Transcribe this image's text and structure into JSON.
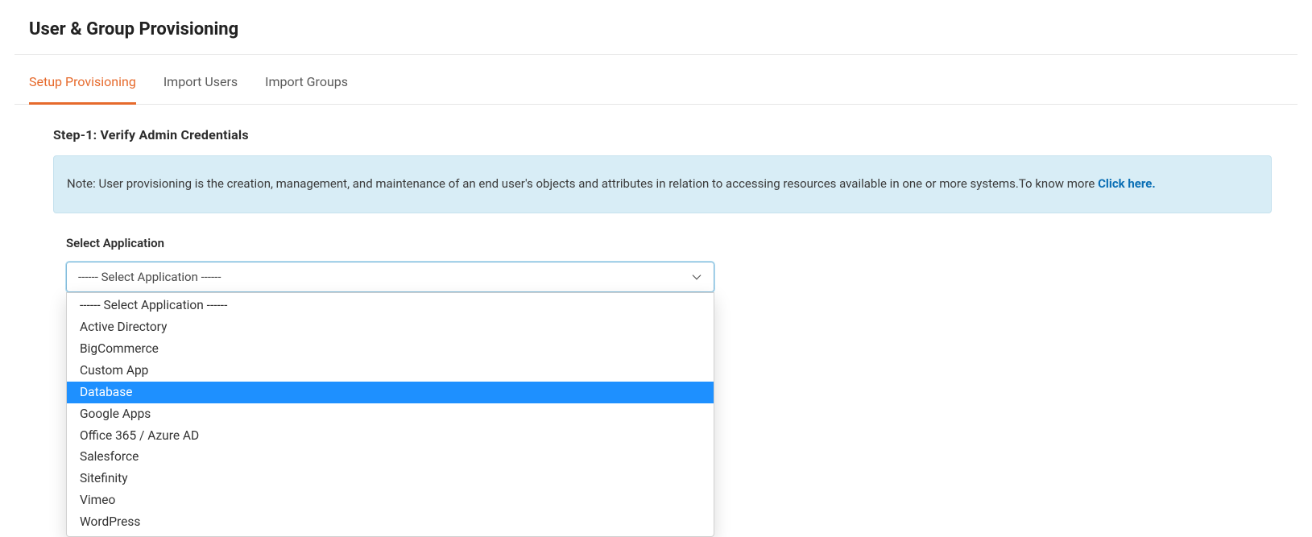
{
  "header": {
    "title": "User & Group Provisioning"
  },
  "tabs": {
    "items": [
      {
        "label": "Setup Provisioning",
        "active": true
      },
      {
        "label": "Import Users",
        "active": false
      },
      {
        "label": "Import Groups",
        "active": false
      }
    ]
  },
  "step": {
    "title": "Step-1: Verify Admin Credentials"
  },
  "note": {
    "prefix": "Note: User provisioning is the creation, management, and maintenance of an end user's objects and attributes in relation to accessing resources available in one or more systems.To know more ",
    "link": "Click here."
  },
  "field": {
    "label": "Select Application",
    "selected": "------ Select Application ------",
    "options": [
      {
        "label": "------ Select Application ------",
        "highlight": false
      },
      {
        "label": "Active Directory",
        "highlight": false
      },
      {
        "label": "BigCommerce",
        "highlight": false
      },
      {
        "label": "Custom App",
        "highlight": false
      },
      {
        "label": "Database",
        "highlight": true
      },
      {
        "label": "Google Apps",
        "highlight": false
      },
      {
        "label": "Office 365 / Azure AD",
        "highlight": false
      },
      {
        "label": "Salesforce",
        "highlight": false
      },
      {
        "label": "Sitefinity",
        "highlight": false
      },
      {
        "label": "Vimeo",
        "highlight": false
      },
      {
        "label": "WordPress",
        "highlight": false
      }
    ]
  }
}
